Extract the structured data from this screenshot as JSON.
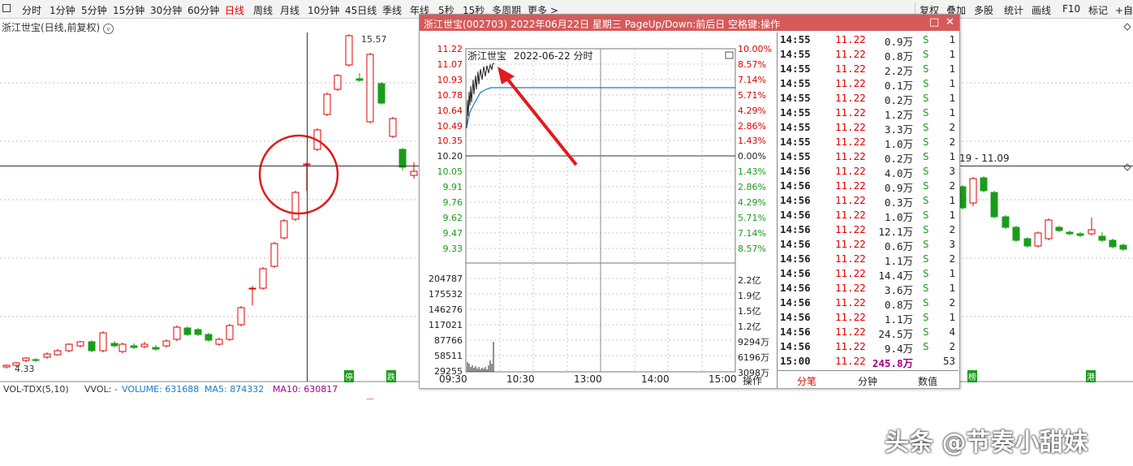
{
  "toolbar": {
    "items": [
      "分时",
      "1分钟",
      "5分钟",
      "15分钟",
      "30分钟",
      "60分钟",
      "日线",
      "周线",
      "月线",
      "10分钟",
      "45日线",
      "季线",
      "年线",
      "5秒",
      "15秒",
      "多周期",
      "更多 >"
    ],
    "active": "日线",
    "right_items": [
      "复权",
      "叠加",
      "多股",
      "统计",
      "画线",
      "F10",
      "标记",
      "+自"
    ]
  },
  "stock_title": "浙江世宝(日线,前复权)",
  "main_chart": {
    "high_label": "15.57",
    "low_label": "4.33",
    "range_label": "19 - 11.09",
    "badges": [
      "停",
      "跌",
      "榜",
      "港"
    ],
    "up_color": "#e00000",
    "down_color": "#1a9c1a"
  },
  "volume_indicator": {
    "name": "VOL-TDX(5,10)",
    "vvol": "VVOL: -",
    "volume": "VOLUME: 631688",
    "ma5": "MA5: 874332",
    "ma10": "MA10: 630817"
  },
  "popup": {
    "title": "浙江世宝(002703)  2022年06月22日  星期三  PageUp/Down:前后日  空格键:操作",
    "buttons": [
      "□",
      "✕"
    ],
    "inner_name": "浙江世宝",
    "inner_date": "2022-06-22 分时",
    "price_labels": [
      "11.22",
      "11.07",
      "10.93",
      "10.78",
      "10.64",
      "10.49",
      "10.35",
      "10.20",
      "10.05",
      "9.91",
      "9.76",
      "9.62",
      "9.47",
      "9.33"
    ],
    "pct_labels": [
      "10.00%",
      "8.57%",
      "7.14%",
      "5.71%",
      "4.29%",
      "2.86%",
      "1.43%",
      "0.00%",
      "1.43%",
      "2.86%",
      "4.29%",
      "5.71%",
      "7.14%",
      "8.57%"
    ],
    "vol_labels": [
      "204787",
      "175532",
      "146276",
      "117021",
      "87766",
      "58511",
      "29255"
    ],
    "amt_labels": [
      "2.2亿",
      "1.9亿",
      "1.5亿",
      "1.2亿",
      "9294万",
      "6196万",
      "3098万"
    ],
    "time_labels": [
      "09:30",
      "10:30",
      "13:00",
      "14:00",
      "15:00"
    ],
    "op_label": "操作",
    "tabs": [
      "分笔",
      "分钟",
      "数值"
    ],
    "ticks": [
      {
        "t": "14:55",
        "p": "11.22",
        "v": "0.9万",
        "s": "S",
        "c": "1"
      },
      {
        "t": "14:55",
        "p": "11.22",
        "v": "0.8万",
        "s": "S",
        "c": "1"
      },
      {
        "t": "14:55",
        "p": "11.22",
        "v": "2.2万",
        "s": "S",
        "c": "1"
      },
      {
        "t": "14:55",
        "p": "11.22",
        "v": "0.1万",
        "s": "S",
        "c": "1"
      },
      {
        "t": "14:55",
        "p": "11.22",
        "v": "0.2万",
        "s": "S",
        "c": "1"
      },
      {
        "t": "14:55",
        "p": "11.22",
        "v": "1.2万",
        "s": "S",
        "c": "1"
      },
      {
        "t": "14:55",
        "p": "11.22",
        "v": "3.3万",
        "s": "S",
        "c": "2"
      },
      {
        "t": "14:55",
        "p": "11.22",
        "v": "1.0万",
        "s": "S",
        "c": "2"
      },
      {
        "t": "14:55",
        "p": "11.22",
        "v": "0.2万",
        "s": "S",
        "c": "1"
      },
      {
        "t": "14:56",
        "p": "11.22",
        "v": "4.0万",
        "s": "S",
        "c": "3"
      },
      {
        "t": "14:56",
        "p": "11.22",
        "v": "0.9万",
        "s": "S",
        "c": "2"
      },
      {
        "t": "14:56",
        "p": "11.22",
        "v": "0.3万",
        "s": "S",
        "c": "1"
      },
      {
        "t": "14:56",
        "p": "11.22",
        "v": "1.0万",
        "s": "S",
        "c": "1"
      },
      {
        "t": "14:56",
        "p": "11.22",
        "v": "12.1万",
        "s": "S",
        "c": "2"
      },
      {
        "t": "14:56",
        "p": "11.22",
        "v": "0.6万",
        "s": "S",
        "c": "3"
      },
      {
        "t": "14:56",
        "p": "11.22",
        "v": "1.1万",
        "s": "S",
        "c": "2"
      },
      {
        "t": "14:56",
        "p": "11.22",
        "v": "14.4万",
        "s": "S",
        "c": "1"
      },
      {
        "t": "14:56",
        "p": "11.22",
        "v": "3.6万",
        "s": "S",
        "c": "1"
      },
      {
        "t": "14:56",
        "p": "11.22",
        "v": "0.8万",
        "s": "S",
        "c": "2"
      },
      {
        "t": "14:56",
        "p": "11.22",
        "v": "1.1万",
        "s": "S",
        "c": "1"
      },
      {
        "t": "14:56",
        "p": "11.22",
        "v": "24.5万",
        "s": "S",
        "c": "4"
      },
      {
        "t": "14:56",
        "p": "11.22",
        "v": "9.4万",
        "s": "S",
        "c": "2"
      },
      {
        "t": "15:00",
        "p": "11.22",
        "v": "245.8万",
        "s": "",
        "c": "53"
      }
    ]
  },
  "watermark": "头条 @节奏小甜妹"
}
